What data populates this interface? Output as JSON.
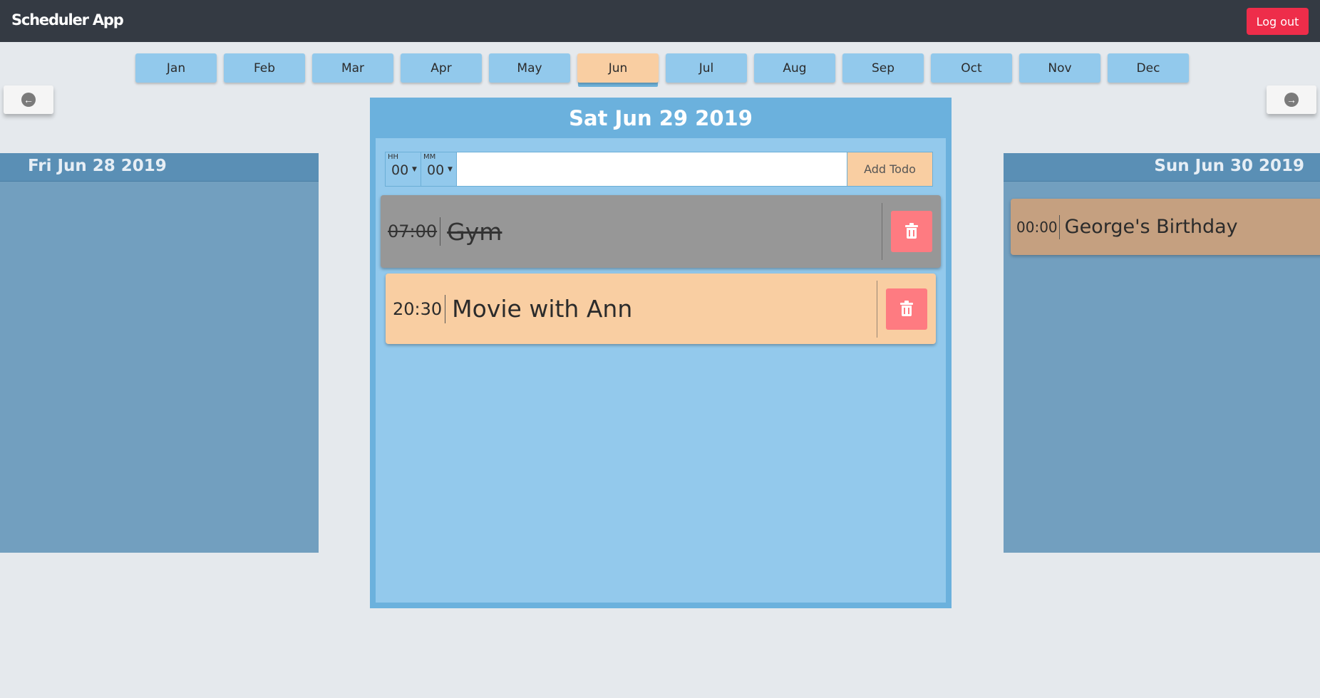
{
  "app": {
    "brand": "Scheduler App",
    "logout_label": "Log out"
  },
  "months": [
    "Jan",
    "Feb",
    "Mar",
    "Apr",
    "May",
    "Jun",
    "Jul",
    "Aug",
    "Sep",
    "Oct",
    "Nov",
    "Dec"
  ],
  "active_month": "Jun",
  "nav": {
    "prev_icon": "arrow-circle-left-icon",
    "next_icon": "arrow-circle-right-icon"
  },
  "prev_day": {
    "title": "Fri Jun 28 2019",
    "todos": []
  },
  "current_day": {
    "title": "Sat Jun 29 2019",
    "form": {
      "hour_label": "HH",
      "hour_value": "00",
      "minute_label": "MM",
      "minute_value": "00",
      "input_value": "",
      "input_placeholder": "",
      "add_label": "Add Todo"
    },
    "todos": [
      {
        "time": "07:00",
        "title": "Gym",
        "done": true
      },
      {
        "time": "20:30",
        "title": "Movie with Ann",
        "done": false
      }
    ]
  },
  "next_day": {
    "title": "Sun Jun 30 2019",
    "todos": [
      {
        "time": "00:00",
        "title": "George's Birthday"
      }
    ]
  },
  "colors": {
    "topbar": "#343a43",
    "logout": "#ee2d4a",
    "month": "#92c9ec",
    "month_active": "#f9cea2",
    "todo_done": "#979797",
    "todo_pending": "#f9cea2",
    "delete": "#fe7b81"
  }
}
